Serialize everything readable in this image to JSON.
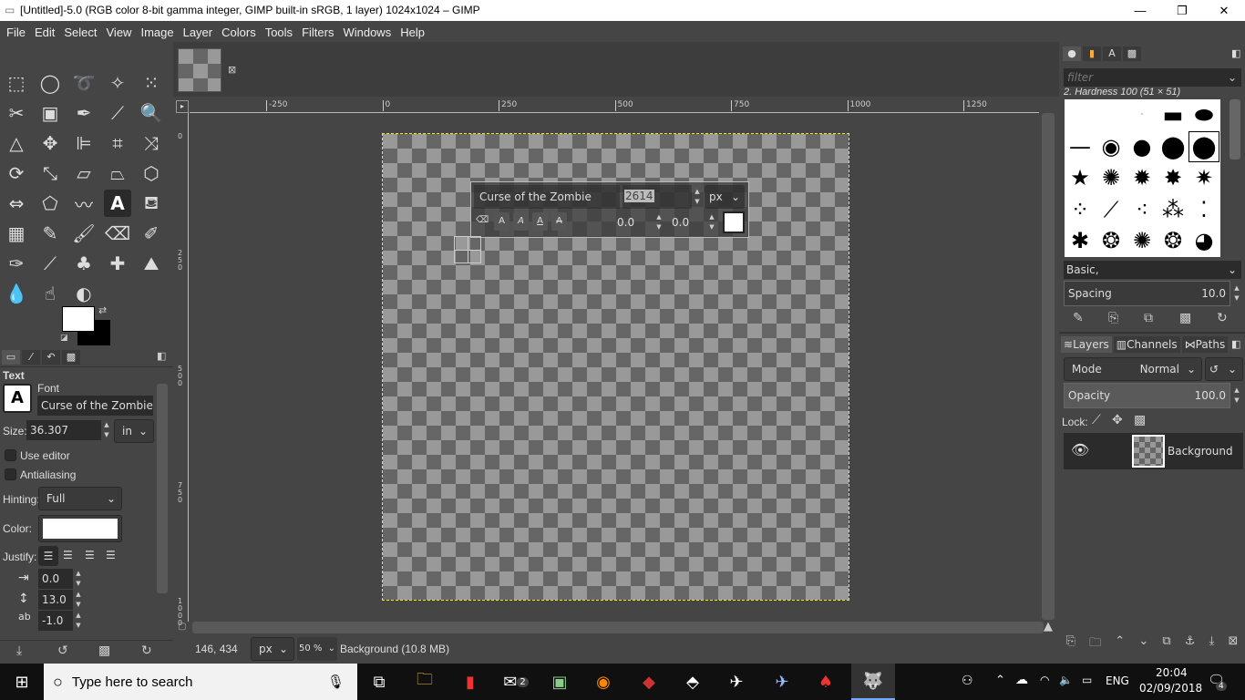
{
  "window": {
    "title": "[Untitled]-5.0 (RGB color 8-bit gamma integer, GIMP built-in sRGB, 1 layer) 1024x1024 – GIMP",
    "minimize": "—",
    "maximize": "❐",
    "close": "✕"
  },
  "menu": [
    "File",
    "Edit",
    "Select",
    "View",
    "Image",
    "Layer",
    "Colors",
    "Tools",
    "Filters",
    "Windows",
    "Help"
  ],
  "toolbox": {
    "tools": [
      {
        "name": "rect-select",
        "glyph": "⬚"
      },
      {
        "name": "ellipse-select",
        "glyph": "◯"
      },
      {
        "name": "free-select",
        "glyph": "➰"
      },
      {
        "name": "fuzzy-select",
        "glyph": "✧"
      },
      {
        "name": "select-by-color",
        "glyph": "⁙"
      },
      {
        "name": "scissors",
        "glyph": "✂"
      },
      {
        "name": "foreground-select",
        "glyph": "▣"
      },
      {
        "name": "paths",
        "glyph": "✒"
      },
      {
        "name": "color-picker",
        "glyph": "⟋"
      },
      {
        "name": "zoom",
        "glyph": "🔍"
      },
      {
        "name": "measure",
        "glyph": "△"
      },
      {
        "name": "move",
        "glyph": "✥"
      },
      {
        "name": "align",
        "glyph": "⊫"
      },
      {
        "name": "crop",
        "glyph": "⌗"
      },
      {
        "name": "unified-transform",
        "glyph": "⤨"
      },
      {
        "name": "rotate",
        "glyph": "⟳"
      },
      {
        "name": "scale",
        "glyph": "⤡"
      },
      {
        "name": "shear",
        "glyph": "▱"
      },
      {
        "name": "perspective",
        "glyph": "⏢"
      },
      {
        "name": "3d-transform",
        "glyph": "⬡"
      },
      {
        "name": "flip",
        "glyph": "⇔"
      },
      {
        "name": "cage",
        "glyph": "⬠"
      },
      {
        "name": "warp",
        "glyph": "〰"
      },
      {
        "name": "text",
        "glyph": "A"
      },
      {
        "name": "bucket-fill",
        "glyph": "⛾"
      },
      {
        "name": "blend",
        "glyph": "▦"
      },
      {
        "name": "pencil",
        "glyph": "✎"
      },
      {
        "name": "paintbrush",
        "glyph": "🖌"
      },
      {
        "name": "eraser",
        "glyph": "⌫"
      },
      {
        "name": "airbrush",
        "glyph": "✐"
      },
      {
        "name": "ink",
        "glyph": "✑"
      },
      {
        "name": "mypaint-brush",
        "glyph": "⟋"
      },
      {
        "name": "clone",
        "glyph": "♣"
      },
      {
        "name": "heal",
        "glyph": "✚"
      },
      {
        "name": "perspective-clone",
        "glyph": "⛰"
      },
      {
        "name": "blur",
        "glyph": "💧"
      },
      {
        "name": "smudge",
        "glyph": "☝"
      },
      {
        "name": "dodge-burn",
        "glyph": "◐"
      }
    ],
    "active_tool": "text",
    "fg_color": "#ffffff",
    "bg_color": "#000000"
  },
  "tool_options": {
    "tabs": [
      "tool-options",
      "device-status",
      "undo-history",
      "images"
    ],
    "title": "Text",
    "font_label": "Font",
    "font_value": "Curse of the Zombie",
    "size_label": "Size:",
    "size_value": "36.307",
    "size_unit": "in",
    "use_editor": "Use editor",
    "antialiasing": "Antialiasing",
    "hinting_label": "Hinting:",
    "hinting_value": "Full",
    "color_label": "Color:",
    "color_value": "#ffffff",
    "justify_label": "Justify:",
    "indent": "0.0",
    "line_spacing": "13.0",
    "letter_spacing": "-1.0",
    "bottom_buttons": [
      "save-preset",
      "restore",
      "delete",
      "reset"
    ]
  },
  "image": {
    "ruler_h": [
      "-250",
      "0",
      "250",
      "500",
      "750",
      "1000",
      "1250"
    ],
    "ruler_v": [
      "0",
      "2\n5\n0",
      "5\n0\n0",
      "7\n5\n0",
      "1\n0\n0\n0"
    ],
    "text_box": {
      "font": "Curse of the Zombie",
      "size": "2614",
      "unit": "px",
      "baseline": "0.0",
      "kerning": "0.0",
      "color": "#ffffff"
    }
  },
  "status": {
    "coords": "146, 434",
    "unit": "px",
    "zoom": "50 %",
    "layer_info": "Background (10.8 MB)"
  },
  "brushes": {
    "filter_placeholder": "filter",
    "brush_name": "2. Hardness 100 (51 × 51)",
    "tag": "Basic,",
    "spacing_label": "Spacing",
    "spacing_value": "10.0"
  },
  "layers": {
    "tabs": [
      "Layers",
      "Channels",
      "Paths"
    ],
    "mode_label": "Mode",
    "mode_value": "Normal",
    "opacity_label": "Opacity",
    "opacity_value": "100.0",
    "lock_label": "Lock:",
    "items": [
      {
        "name": "Background",
        "visible": true
      }
    ]
  },
  "taskbar": {
    "search_placeholder": "Type here to search",
    "mail_badge": "2",
    "language": "ENG",
    "time": "20:04",
    "date": "02/09/2018",
    "notifications": "4"
  }
}
